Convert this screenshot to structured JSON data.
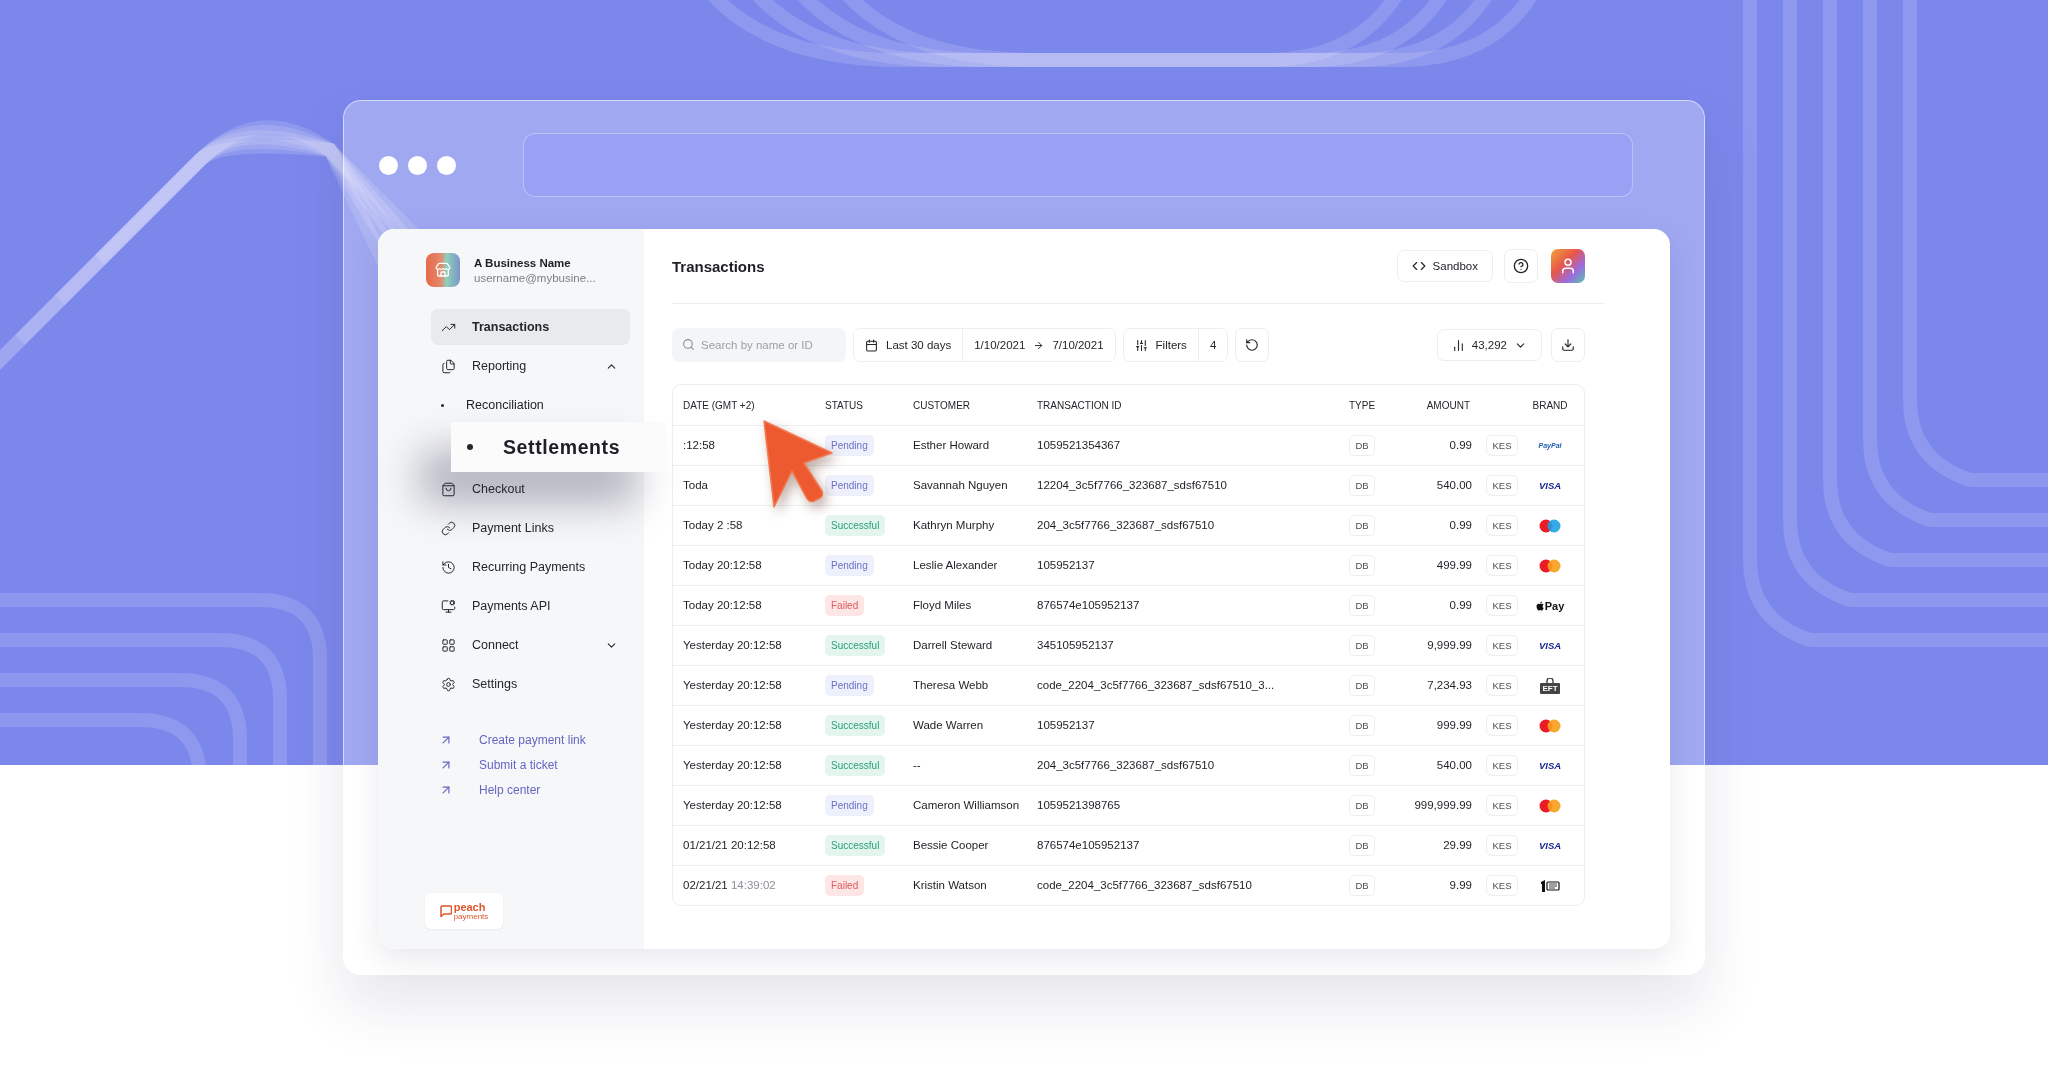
{
  "business": {
    "name": "A Business Name",
    "email": "username@mybusine..."
  },
  "nav": [
    {
      "label": "Transactions",
      "selected": true
    },
    {
      "label": "Reporting",
      "selected": false,
      "expanded": true,
      "children": [
        {
          "label": "Reconciliation",
          "highlighted": false
        },
        {
          "label": "Settlements",
          "highlighted": true
        }
      ]
    },
    {
      "label": "Checkout",
      "selected": false
    },
    {
      "label": "Payment Links",
      "selected": false
    },
    {
      "label": "Recurring Payments",
      "selected": false
    },
    {
      "label": "Payments API",
      "selected": false
    },
    {
      "label": "Connect",
      "selected": false,
      "expanded": false
    },
    {
      "label": "Settings",
      "selected": false
    }
  ],
  "links": [
    "Create payment link",
    "Submit a ticket",
    "Help center"
  ],
  "logo": {
    "name": "peach",
    "tagline": "payments"
  },
  "header": {
    "title": "Transactions",
    "sandbox": "Sandbox"
  },
  "toolbar": {
    "search": {
      "placeholder": "Search by name or ID"
    },
    "period": "Last 30 days",
    "date_from": "1/10/2021",
    "date_to": "7/10/2021",
    "filters": "Filters",
    "filter_count": "4",
    "total": "43,292"
  },
  "table": {
    "columns": [
      "DATE (GMT +2)",
      "STATUS",
      "CUSTOMER",
      "TRANSACTION ID",
      "TYPE",
      "AMOUNT",
      "BRAND"
    ],
    "rows": [
      {
        "date": ":12:58",
        "status": {
          "label": "Pending",
          "kind": "pending"
        },
        "customer": "Esther Howard",
        "id": "1059521354367",
        "type": "DB",
        "amount": "0.99",
        "currency": "KES",
        "brand": {
          "kind": "paypal",
          "label": "PayPal"
        }
      },
      {
        "date": "Toda",
        "status": {
          "label": "Pending",
          "kind": "pending"
        },
        "customer": "Savannah Nguyen",
        "id": "12204_3c5f7766_323687_sdsf67510",
        "type": "DB",
        "amount": "540.00",
        "currency": "KES",
        "brand": {
          "kind": "visa",
          "label": "VISA"
        }
      },
      {
        "date": "Today 2 :58",
        "status": {
          "label": "Successful",
          "kind": "successful"
        },
        "customer": "Kathryn Murphy",
        "id": "204_3c5f7766_323687_sdsf67510",
        "type": "DB",
        "amount": "0.99",
        "currency": "KES",
        "brand": {
          "kind": "maestro"
        }
      },
      {
        "date": "Today 20:12:58",
        "status": {
          "label": "Pending",
          "kind": "pending"
        },
        "customer": "Leslie Alexander",
        "id": "105952137",
        "type": "DB",
        "amount": "499.99",
        "currency": "KES",
        "brand": {
          "kind": "mastercard"
        }
      },
      {
        "date": "Today 20:12:58",
        "status": {
          "label": "Failed",
          "kind": "failed"
        },
        "customer": "Floyd Miles",
        "id": "876574e105952137",
        "type": "DB",
        "amount": "0.99",
        "currency": "KES",
        "brand": {
          "kind": "applepay",
          "label": "Pay"
        }
      },
      {
        "date": "Yesterday 20:12:58",
        "status": {
          "label": "Successful",
          "kind": "successful"
        },
        "customer": "Darrell Steward",
        "id": "345105952137",
        "type": "DB",
        "amount": "9,999.99",
        "currency": "KES",
        "brand": {
          "kind": "visa",
          "label": "VISA"
        }
      },
      {
        "date": "Yesterday 20:12:58",
        "status": {
          "label": "Pending",
          "kind": "pending"
        },
        "customer": "Theresa Webb",
        "id": "code_2204_3c5f7766_323687_sdsf67510_3...",
        "type": "DB",
        "amount": "7,234.93",
        "currency": "KES",
        "brand": {
          "kind": "eft",
          "label": "EFT"
        }
      },
      {
        "date": "Yesterday 20:12:58",
        "status": {
          "label": "Successful",
          "kind": "successful"
        },
        "customer": "Wade Warren",
        "id": "105952137",
        "type": "DB",
        "amount": "999.99",
        "currency": "KES",
        "brand": {
          "kind": "mastercard"
        }
      },
      {
        "date": "Yesterday 20:12:58",
        "status": {
          "label": "Successful",
          "kind": "successful"
        },
        "customer": "--",
        "id": "204_3c5f7766_323687_sdsf67510",
        "type": "DB",
        "amount": "540.00",
        "currency": "KES",
        "brand": {
          "kind": "visa",
          "label": "VISA"
        }
      },
      {
        "date": "Yesterday 20:12:58",
        "status": {
          "label": "Pending",
          "kind": "pending"
        },
        "customer": "Cameron Williamson",
        "id": "1059521398765",
        "type": "DB",
        "amount": "999,999.99",
        "currency": "KES",
        "brand": {
          "kind": "mastercard"
        }
      },
      {
        "date": "01/21/21 20:12:58",
        "status": {
          "label": "Successful",
          "kind": "successful"
        },
        "customer": "Bessie Cooper",
        "id": "876574e105952137",
        "type": "DB",
        "amount": "29.99",
        "currency": "KES",
        "brand": {
          "kind": "visa",
          "label": "VISA"
        }
      },
      {
        "date": "02/21/21",
        "time": "14:39:02",
        "status": {
          "label": "Failed",
          "kind": "failed"
        },
        "customer": "Kristin Watson",
        "id": "code_2204_3c5f7766_323687_sdsf67510",
        "type": "DB",
        "amount": "9.99",
        "currency": "KES",
        "brand": {
          "kind": "voucher"
        }
      }
    ]
  }
}
